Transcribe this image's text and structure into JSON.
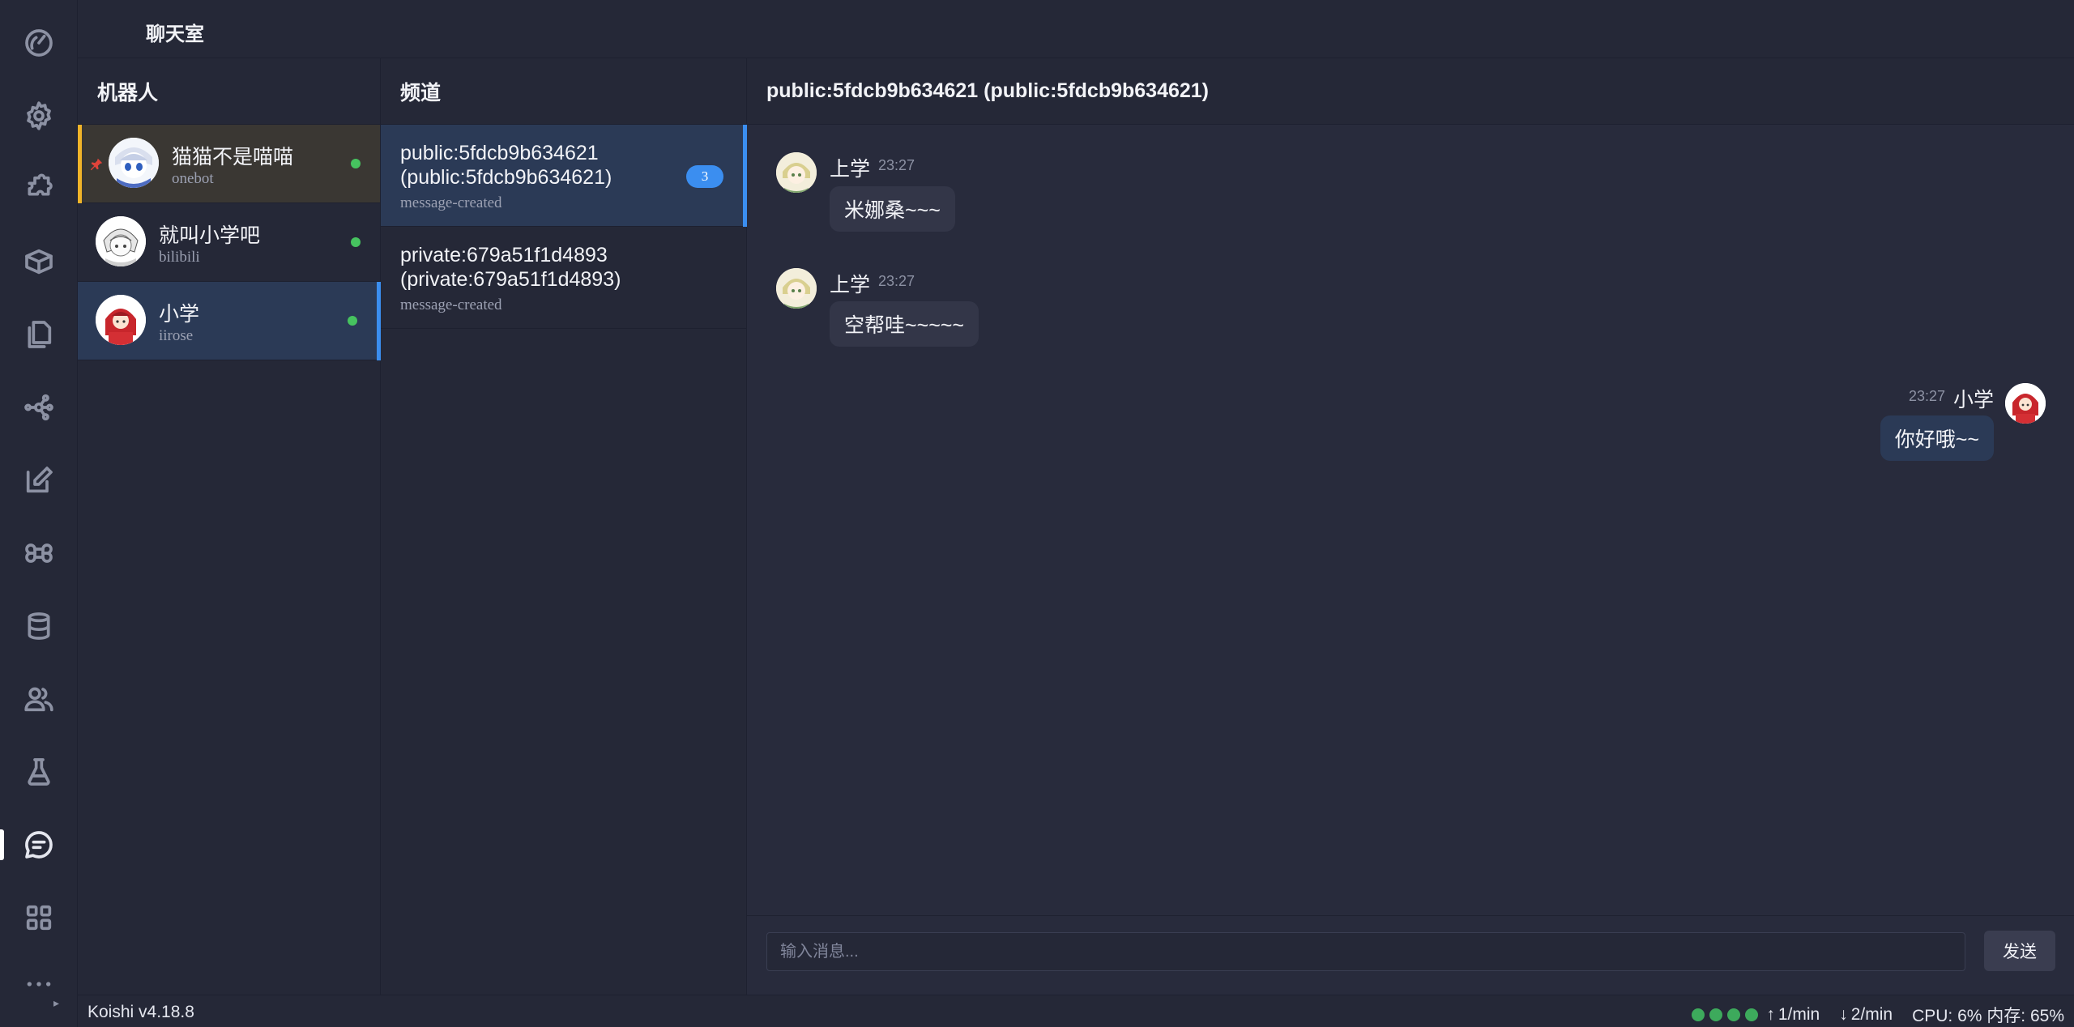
{
  "app": {
    "title": "聊天室"
  },
  "activity_bar": {
    "items": [
      {
        "icon": "dashboard-icon"
      },
      {
        "icon": "gear-icon"
      },
      {
        "icon": "puzzle-icon"
      },
      {
        "icon": "package-icon"
      },
      {
        "icon": "files-icon"
      },
      {
        "icon": "graph-icon"
      },
      {
        "icon": "edit-icon"
      },
      {
        "icon": "command-icon"
      },
      {
        "icon": "database-icon"
      },
      {
        "icon": "users-icon"
      },
      {
        "icon": "flask-icon"
      },
      {
        "icon": "chat-icon",
        "active": true
      },
      {
        "icon": "grid-icon"
      },
      {
        "icon": "more-icon"
      }
    ]
  },
  "bots": {
    "header": "机器人",
    "items": [
      {
        "name": "猫猫不是喵喵",
        "platform": "onebot",
        "status": "online",
        "pinned": true
      },
      {
        "name": "就叫小学吧",
        "platform": "bilibili",
        "status": "online"
      },
      {
        "name": "小学",
        "platform": "iirose",
        "status": "online",
        "selected": true
      }
    ]
  },
  "channels": {
    "header": "频道",
    "items": [
      {
        "title": "public:5fdcb9b634621 (public:5fdcb9b634621)",
        "event": "message-created",
        "unread": "3",
        "active": true
      },
      {
        "title": "private:679a51f1d4893 (private:679a51f1d4893)",
        "event": "message-created"
      }
    ]
  },
  "chat": {
    "header": "public:5fdcb9b634621 (public:5fdcb9b634621)",
    "messages": [
      {
        "user": "上学",
        "time": "23:27",
        "text": "米娜桑~~~"
      },
      {
        "user": "上学",
        "time": "23:27",
        "text": "空帮哇~~~~~"
      },
      {
        "user": "小学",
        "time": "23:27",
        "text": "你好哦~~",
        "self": true
      }
    ],
    "input_placeholder": "输入消息...",
    "send_label": "发送"
  },
  "status_bar": {
    "version": "Koishi v4.18.8",
    "upload_rate": "1/min",
    "download_rate": "2/min",
    "cpu_mem": "CPU: 6% 内存: 65%"
  },
  "colors": {
    "accent": "#3b8ef0",
    "online": "#46c35f",
    "pinned": "#f0b429",
    "background": "#252837"
  }
}
